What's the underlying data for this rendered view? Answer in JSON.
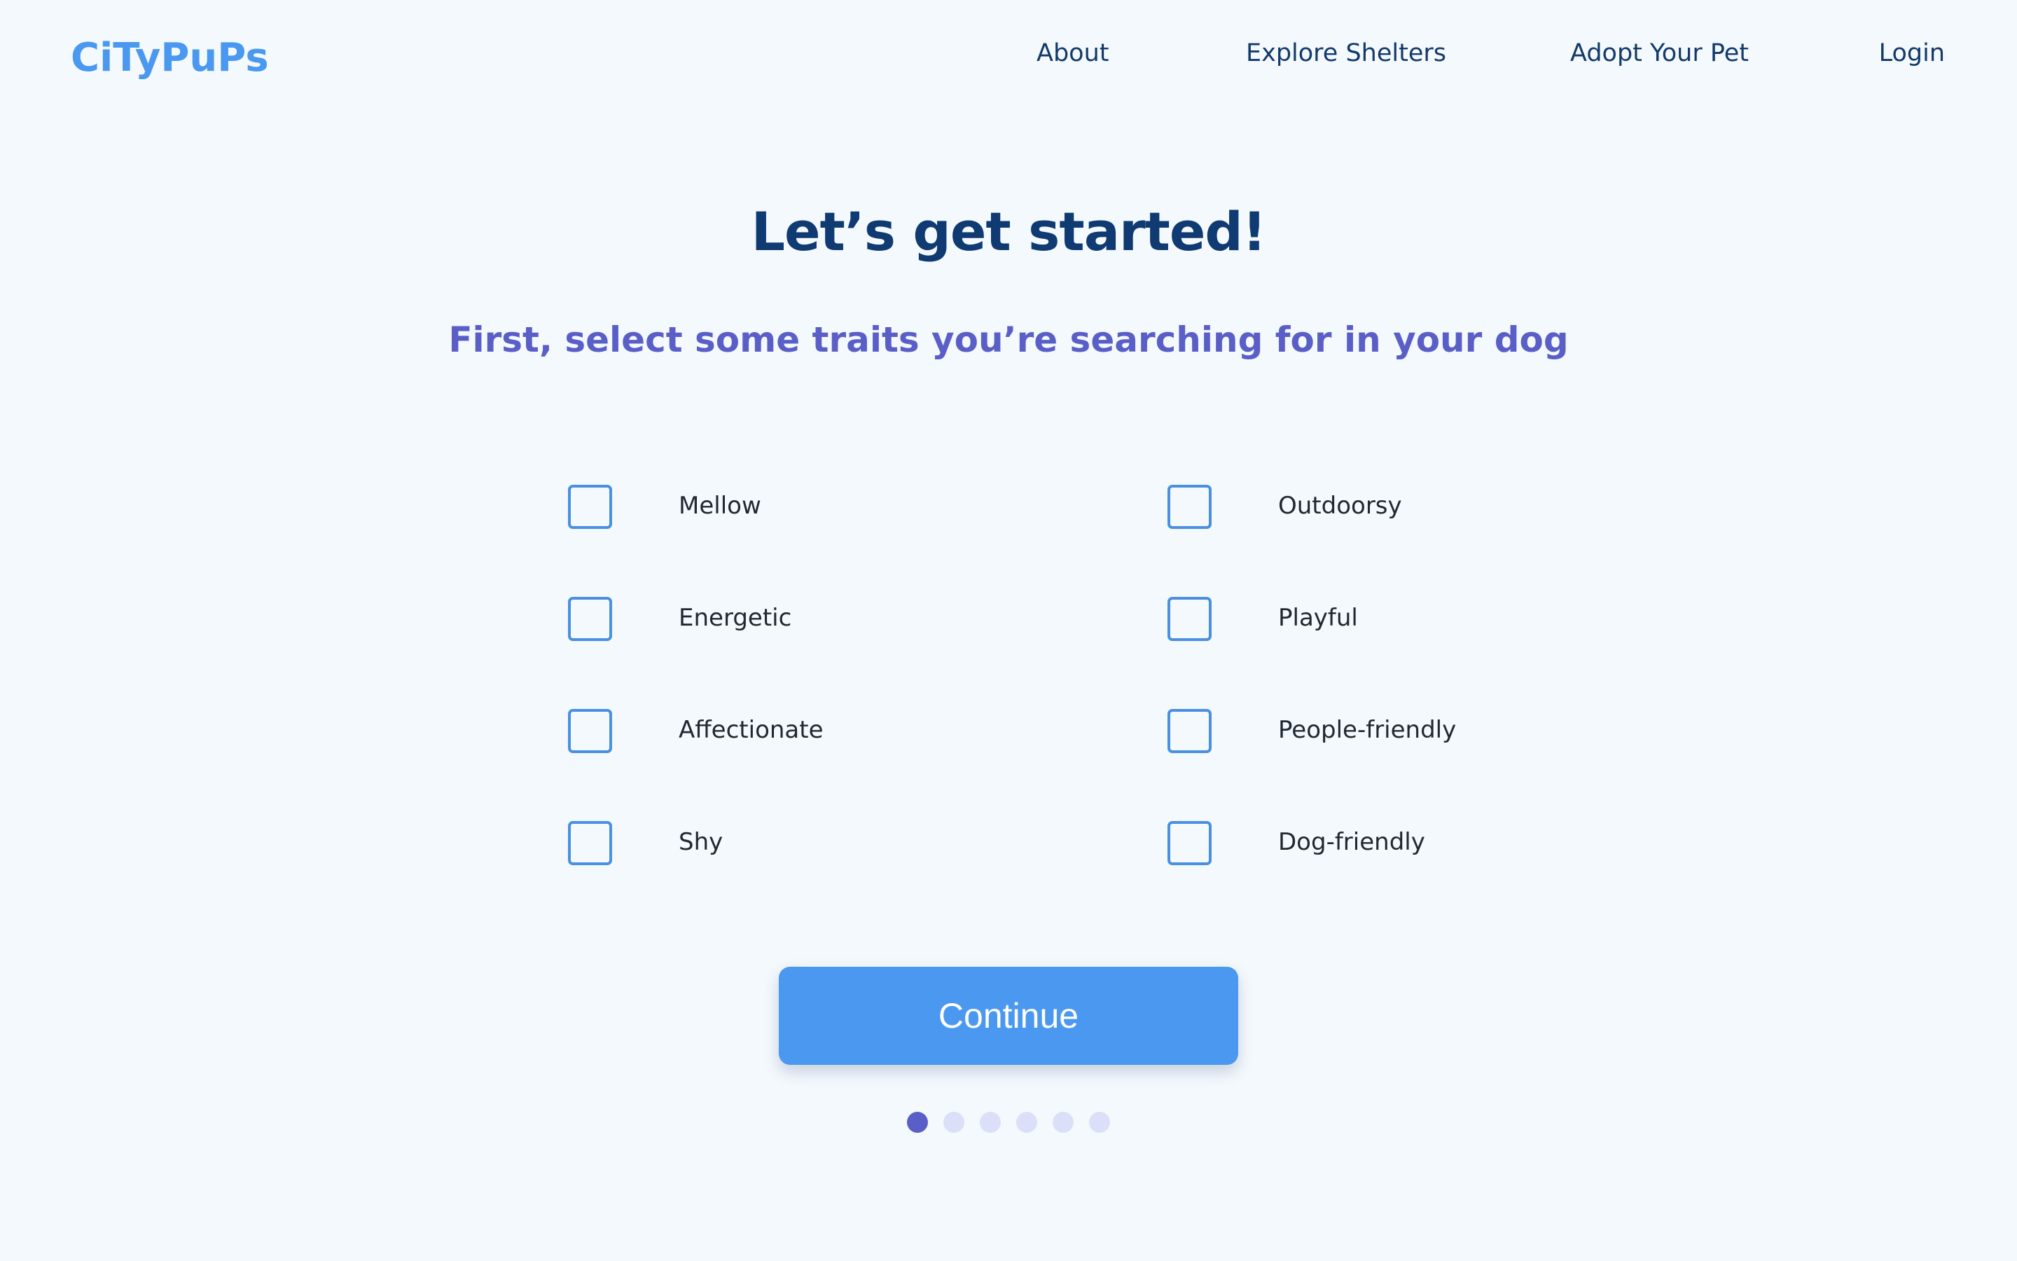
{
  "brand": {
    "logo_text": "CiTyPuPs"
  },
  "nav": {
    "about": "About",
    "explore_shelters": "Explore Shelters",
    "adopt_your_pet": "Adopt Your Pet",
    "login": "Login"
  },
  "main": {
    "title": "Let’s get started!",
    "subtitle": "First, select some traits you’re searching for in your dog",
    "traits_left": [
      {
        "label": "Mellow",
        "checked": false
      },
      {
        "label": "Energetic",
        "checked": false
      },
      {
        "label": "Affectionate",
        "checked": false
      },
      {
        "label": "Shy",
        "checked": false
      }
    ],
    "traits_right": [
      {
        "label": "Outdoorsy",
        "checked": false
      },
      {
        "label": "Playful",
        "checked": false
      },
      {
        "label": "People-friendly",
        "checked": false
      },
      {
        "label": "Dog-friendly",
        "checked": false
      }
    ],
    "continue_label": "Continue"
  },
  "progress": {
    "total_steps": 6,
    "current_step": 1
  },
  "colors": {
    "background": "#f4f9fd",
    "brand_blue": "#4a98f0",
    "navy": "#0f3a72",
    "purple": "#5a5fc8",
    "dot_inactive": "#dcdff8",
    "checkbox_border": "#4a90e2"
  }
}
